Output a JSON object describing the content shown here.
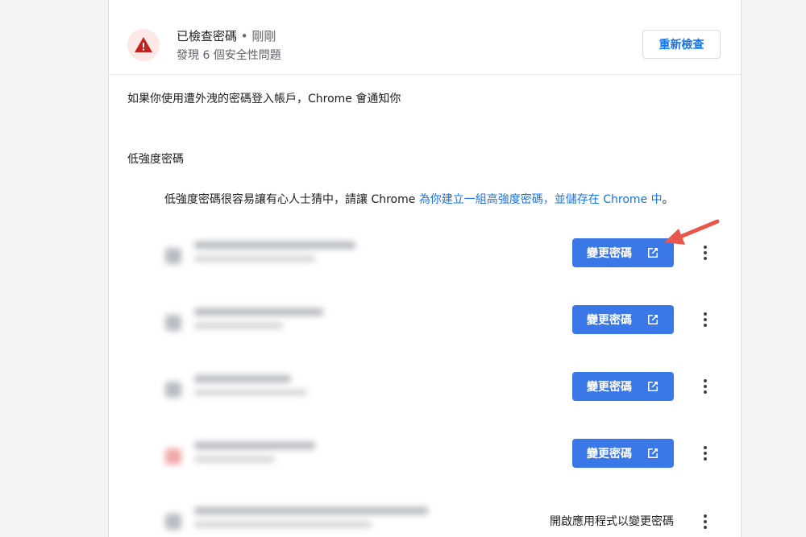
{
  "check": {
    "title": "已檢查密碼",
    "separator": " • ",
    "time": "剛剛",
    "subtitle": "發現 6 個安全性問題",
    "recheck_label": "重新檢查"
  },
  "notify_text": "如果你使用遭外洩的密碼登入帳戶，Chrome 會通知你",
  "weak": {
    "title": "低強度密碼",
    "desc_plain": "低強度密碼很容易讓有心人士猜中，請讓 Chrome ",
    "desc_link": "為你建立一組高強度密碼，並儲存在 Chrome 中",
    "desc_end": "。"
  },
  "rows": [
    {
      "action_label": "變更密碼"
    },
    {
      "action_label": "變更密碼"
    },
    {
      "action_label": "變更密碼"
    },
    {
      "action_label": "變更密碼"
    },
    {
      "action_text": "開啟應用程式以變更密碼"
    }
  ],
  "colors": {
    "accent": "#1a73e8",
    "button_bg": "#3b78e7",
    "warning_red": "#c5221f",
    "warning_bg": "#fce8e6",
    "annotation_arrow": "#e8574a"
  },
  "icons": {
    "warning": "warning-triangle-icon",
    "external": "open-in-new-icon",
    "more": "more-vert-icon"
  }
}
